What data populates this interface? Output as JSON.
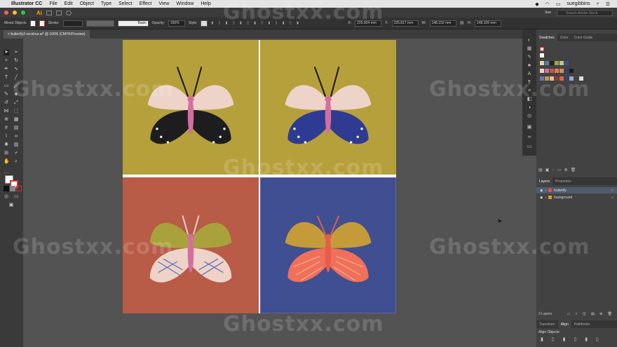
{
  "macbar": {
    "app_name": "Illustrator CC",
    "menus": [
      "File",
      "Edit",
      "Object",
      "Type",
      "Select",
      "Effect",
      "View",
      "Window",
      "Help"
    ],
    "user": "suegibbins"
  },
  "appbar": {
    "workspace": "Sue",
    "search_placeholder": "Search Adobe Stock"
  },
  "control": {
    "selection_label": "Mixed Objects",
    "stroke_label": "Stroke:",
    "brush_label": "Basic",
    "opacity_label": "Opacity:",
    "opacity_value": "100%",
    "style_label": "Style:",
    "x_label": "X:",
    "x_value": "225.924 mm",
    "y_label": "Y:",
    "y_value": "225.817 mm",
    "w_label": "W:",
    "w_value": "148.152 mm",
    "h_label": "H:",
    "h_value": "148.326 mm"
  },
  "document": {
    "tab_title": "butterfly2-recolour.ai* @ 100% (CMYK/Preview)",
    "colors": {
      "gold": "#b5a03b",
      "terracotta": "#b85b47",
      "navy": "#3f4f91"
    }
  },
  "panels": {
    "swatches_tabs": [
      "Swatches",
      "Color",
      "Color Guide"
    ],
    "layers_tabs": [
      "Layers",
      "Properties"
    ],
    "layers": [
      {
        "name": "butterfly",
        "color": "#e24d4d"
      },
      {
        "name": "background",
        "color": "#e29a30"
      }
    ],
    "layer_count": "2 Layers",
    "bottom_tabs": [
      "Transform",
      "Align",
      "Pathfinder"
    ],
    "align_label": "Align Objects:"
  },
  "watermark": "Ghostxx.com"
}
